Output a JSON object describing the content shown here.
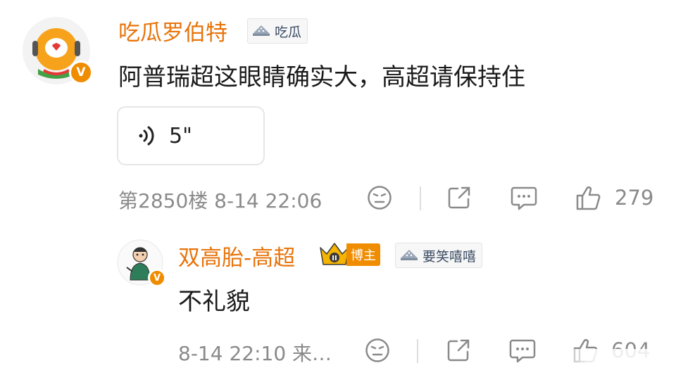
{
  "main_comment": {
    "username": "吃瓜罗伯特",
    "tag_label": "吃瓜",
    "text": "阿普瑞超这眼睛确实大，高超请保持住",
    "voice_length": "5\"",
    "meta": "第2850楼 8-14 22:06",
    "like_count": "279"
  },
  "reply": {
    "username": "双高胎-高超",
    "crown_label": "博主",
    "tag_label": "要笑嘻嘻",
    "text": "不礼貌",
    "meta": "8-14 22:10 来…",
    "like_count": "604"
  },
  "colors": {
    "username": "#e8740c",
    "vip_badge": "#f08c00",
    "meta_gray": "#8a8a8a"
  },
  "icons": [
    "emoji-neutral-icon",
    "share-icon",
    "comment-icon",
    "thumbs-up-icon",
    "watermelon-icon",
    "crown-icon",
    "voice-wave-icon",
    "verified-v-icon"
  ]
}
